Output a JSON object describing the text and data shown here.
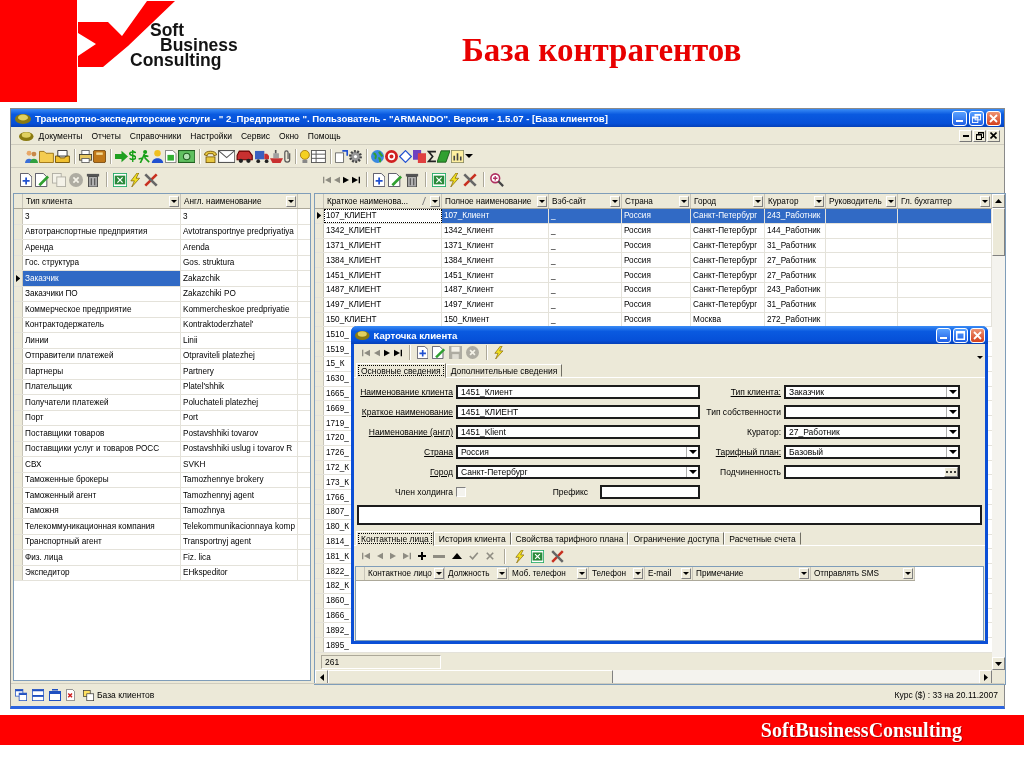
{
  "slide": {
    "logo": [
      "Soft",
      "Business",
      "Consulting"
    ],
    "title": "База контрагентов",
    "footer": "SoftBusinessConsulting"
  },
  "window": {
    "title": "Транспортно-экспедиторские услуги - \" 2_Предприятие \". Пользователь - \"ARMANDO\". Версия - 1.5.07 - [База клиентов]"
  },
  "menu": [
    "Документы",
    "Отчеты",
    "Справочники",
    "Настройки",
    "Сервис",
    "Окно",
    "Помощь"
  ],
  "left_panel": {
    "toolbar": [
      {
        "disabled": false
      },
      {
        "disabled": false
      },
      {
        "disabled": true
      },
      {
        "disabled": true
      },
      {
        "disabled": false
      },
      {
        "disabled": false
      },
      {
        "disabled": false
      },
      {
        "disabled": false
      }
    ],
    "table": {
      "row_select": false,
      "columns": [
        {
          "label": "Тип клиента",
          "current": true,
          "sorted": false
        },
        {
          "label": "Англ. наименование",
          "current": false,
          "sorted": false
        }
      ],
      "rows": [
        {
          "cells": [
            "3",
            "3"
          ],
          "selected": false
        },
        {
          "cells": [
            "Автотранспортные предприятия",
            "Avtotransportnye predpriyatiya"
          ],
          "selected": false
        },
        {
          "cells": [
            "Аренда",
            "Arenda"
          ],
          "selected": false
        },
        {
          "cells": [
            "Гос. структура",
            "Gos. struktura"
          ],
          "selected": false
        },
        {
          "cells": [
            "Заказчик",
            "Zakazchik"
          ],
          "selected": true
        },
        {
          "cells": [
            "Заказчики ПО",
            "Zakazchiki PO"
          ],
          "selected": false
        },
        {
          "cells": [
            "Коммерческое предприятие",
            "Kommercheskoe predpriyatie"
          ],
          "selected": false
        },
        {
          "cells": [
            "Контрактодержатель",
            "Kontraktoderzhatel'"
          ],
          "selected": false
        },
        {
          "cells": [
            "Линии",
            "Linii"
          ],
          "selected": false
        },
        {
          "cells": [
            "Отправители платежей",
            "Otpraviteli platezhej"
          ],
          "selected": false
        },
        {
          "cells": [
            "Партнеры",
            "Partnery"
          ],
          "selected": false
        },
        {
          "cells": [
            "Плательщик",
            "Platel'shhik"
          ],
          "selected": false
        },
        {
          "cells": [
            "Получатели платежей",
            "Poluchateli platezhej"
          ],
          "selected": false
        },
        {
          "cells": [
            "Порт",
            "Port"
          ],
          "selected": false
        },
        {
          "cells": [
            "Поставщики товаров",
            "Postavshhiki tovarov"
          ],
          "selected": false
        },
        {
          "cells": [
            "Поставщики услуг и товаров РОСС",
            "Postavshhiki uslug i tovarov R"
          ],
          "selected": false
        },
        {
          "cells": [
            "СВХ",
            "SVKH"
          ],
          "selected": false
        },
        {
          "cells": [
            "Таможенные брокеры",
            "Tamozhennye brokery"
          ],
          "selected": false
        },
        {
          "cells": [
            "Таможенный агент",
            "Tamozhennyj agent"
          ],
          "selected": false
        },
        {
          "cells": [
            "Таможня",
            "Tamozhnya"
          ],
          "selected": false
        },
        {
          "cells": [
            "Телекоммуникационная компания",
            "Telekommunikacionnaya komp"
          ],
          "selected": false
        },
        {
          "cells": [
            "Транспортный агент",
            "Transportnyj agent"
          ],
          "selected": false
        },
        {
          "cells": [
            "Физ. лица",
            "Fiz. lica"
          ],
          "selected": false
        },
        {
          "cells": [
            "Экспедитор",
            "EHkspeditor"
          ],
          "selected": false
        }
      ]
    }
  },
  "right_panel": {
    "toolbar": [
      {
        "disabled": true
      },
      {
        "disabled": true
      },
      {
        "disabled": false
      },
      {
        "disabled": false
      },
      {
        "disabled": false
      },
      {
        "disabled": false
      },
      {
        "disabled": false
      },
      {
        "disabled": false
      },
      {
        "disabled": false
      },
      {
        "disabled": false
      },
      {
        "disabled": false
      }
    ],
    "table": {
      "row_select": true,
      "columns": [
        {
          "label": "Краткое наименова...",
          "current": true,
          "sorted": true
        },
        {
          "label": "Полное наименование",
          "current": false,
          "sorted": false
        },
        {
          "label": "Вэб-сайт",
          "current": false,
          "sorted": false
        },
        {
          "label": "Страна",
          "current": false,
          "sorted": false
        },
        {
          "label": "Город",
          "current": false,
          "sorted": false
        },
        {
          "label": "Куратор",
          "current": false,
          "sorted": false
        },
        {
          "label": "Руководитель",
          "current": false,
          "sorted": false
        },
        {
          "label": "Гл. бухгалтер",
          "current": false,
          "sorted": false
        }
      ],
      "rows": [
        {
          "cells": [
            "107_КЛИЕНТ",
            "107_Клиент",
            "_",
            "Россия",
            "Санкт-Петербург",
            "243_Работник"
          ],
          "selected": true
        },
        {
          "cells": [
            "1342_КЛИЕНТ",
            "1342_Клиент",
            "_",
            "Россия",
            "Санкт-Петербург",
            "144_Работник"
          ],
          "selected": false
        },
        {
          "cells": [
            "1371_КЛИЕНТ",
            "1371_Клиент",
            "_",
            "Россия",
            "Санкт-Петербург",
            "31_Работник"
          ],
          "selected": false
        },
        {
          "cells": [
            "1384_КЛИЕНТ",
            "1384_Клиент",
            "_",
            "Россия",
            "Санкт-Петербург",
            "27_Работник"
          ],
          "selected": false
        },
        {
          "cells": [
            "1451_КЛИЕНТ",
            "1451_Клиент",
            "_",
            "Россия",
            "Санкт-Петербург",
            "27_Работник"
          ],
          "selected": false
        },
        {
          "cells": [
            "1487_КЛИЕНТ",
            "1487_Клиент",
            "_",
            "Россия",
            "Санкт-Петербург",
            "243_Работник"
          ],
          "selected": false
        },
        {
          "cells": [
            "1497_КЛИЕНТ",
            "1497_Клиент",
            "_",
            "Россия",
            "Санкт-Петербург",
            "31_Работник"
          ],
          "selected": false
        },
        {
          "cells": [
            "150_КЛИЕНТ",
            "150_Клиент",
            "_",
            "Россия",
            "Москва",
            "272_Работник"
          ],
          "selected": false
        },
        {
          "cells": [
            "1510_"
          ],
          "selected": false
        },
        {
          "cells": [
            "1519_"
          ],
          "selected": false
        },
        {
          "cells": [
            "15_К"
          ],
          "selected": false
        },
        {
          "cells": [
            "1630_"
          ],
          "selected": false
        },
        {
          "cells": [
            "1665_"
          ],
          "selected": false
        },
        {
          "cells": [
            "1669_"
          ],
          "selected": false
        },
        {
          "cells": [
            "1719_"
          ],
          "selected": false
        },
        {
          "cells": [
            "1720_"
          ],
          "selected": false
        },
        {
          "cells": [
            "1726_"
          ],
          "selected": false
        },
        {
          "cells": [
            "172_К"
          ],
          "selected": false
        },
        {
          "cells": [
            "173_К"
          ],
          "selected": false
        },
        {
          "cells": [
            "1766_"
          ],
          "selected": false
        },
        {
          "cells": [
            "1807_"
          ],
          "selected": false
        },
        {
          "cells": [
            "180_К"
          ],
          "selected": false
        },
        {
          "cells": [
            "1814_"
          ],
          "selected": false
        },
        {
          "cells": [
            "181_К"
          ],
          "selected": false
        },
        {
          "cells": [
            "1822_"
          ],
          "selected": false
        },
        {
          "cells": [
            "182_К"
          ],
          "selected": false
        },
        {
          "cells": [
            "1860_"
          ],
          "selected": false
        },
        {
          "cells": [
            "1866_"
          ],
          "selected": false
        },
        {
          "cells": [
            "1892_"
          ],
          "selected": false
        },
        {
          "cells": [
            "1895_"
          ],
          "selected": false
        }
      ]
    },
    "record_count": "261"
  },
  "card": {
    "title": "Карточка клиента",
    "toolbar": [
      {
        "disabled": true
      },
      {
        "disabled": true
      },
      {
        "disabled": false
      },
      {
        "disabled": false
      },
      {
        "disabled": false
      },
      {
        "disabled": false
      },
      {
        "disabled": true
      },
      {
        "disabled": true
      },
      {
        "disabled": false
      }
    ],
    "tabs": [
      {
        "label": "Основные сведения",
        "selected": true
      },
      {
        "label": "Дополнительные сведения",
        "selected": false
      }
    ],
    "left_fields": [
      {
        "label": "Наименование клиента",
        "link": true,
        "kind": "text",
        "value": "1451_Клиент"
      },
      {
        "label": "Краткое наименование",
        "link": true,
        "kind": "text",
        "value": "1451_КЛИЕНТ"
      },
      {
        "label": "Наименование (англ)",
        "link": true,
        "kind": "text",
        "value": "1451_Klient"
      },
      {
        "label": "Страна",
        "link": true,
        "kind": "combo",
        "value": "Россия"
      },
      {
        "label": "Город",
        "link": true,
        "kind": "combo",
        "value": "Санкт-Петербург"
      }
    ],
    "right_fields": [
      {
        "label": "Тип клиента:",
        "link": true,
        "kind": "combo",
        "value": "Заказчик"
      },
      {
        "label": "Тип собственности",
        "link": false,
        "kind": "combo"
      },
      {
        "label": "Куратор:",
        "link": false,
        "kind": "combo",
        "value": "27_Работник"
      },
      {
        "label": "Тарифный план:",
        "link": true,
        "kind": "combo",
        "value": "Базовый"
      },
      {
        "label": "Подчиненность",
        "link": false,
        "kind": "lookup"
      }
    ],
    "holding": {
      "label": "Член холдинга",
      "checked": false
    },
    "prefix": {
      "label": "Префикс"
    },
    "subtabs": [
      {
        "label": "Контактные лица",
        "selected": true
      },
      {
        "label": "История клиента",
        "selected": false
      },
      {
        "label": "Свойства тарифного плана",
        "selected": false
      },
      {
        "label": "Ограничение доступа",
        "selected": false
      },
      {
        "label": "Расчетные счета",
        "selected": false
      }
    ],
    "subtoolbar": [
      {
        "disabled": true
      },
      {
        "disabled": true
      },
      {
        "disabled": true
      },
      {
        "disabled": true
      },
      {
        "disabled": false
      },
      {
        "disabled": true
      },
      {
        "disabled": false
      },
      {
        "disabled": true
      },
      {
        "disabled": true
      },
      {
        "disabled": false
      },
      {
        "disabled": false
      },
      {
        "disabled": false
      }
    ],
    "contacts_columns": [
      "Контактное лицо",
      "Должность",
      "Моб. телефон",
      "Телефон",
      "E-mail",
      "Примечание",
      "Отправлять SMS"
    ]
  },
  "status_bar": {
    "window_button": "База клиентов",
    "rate": "Курс ($) : 33 на 20.11.2007"
  }
}
